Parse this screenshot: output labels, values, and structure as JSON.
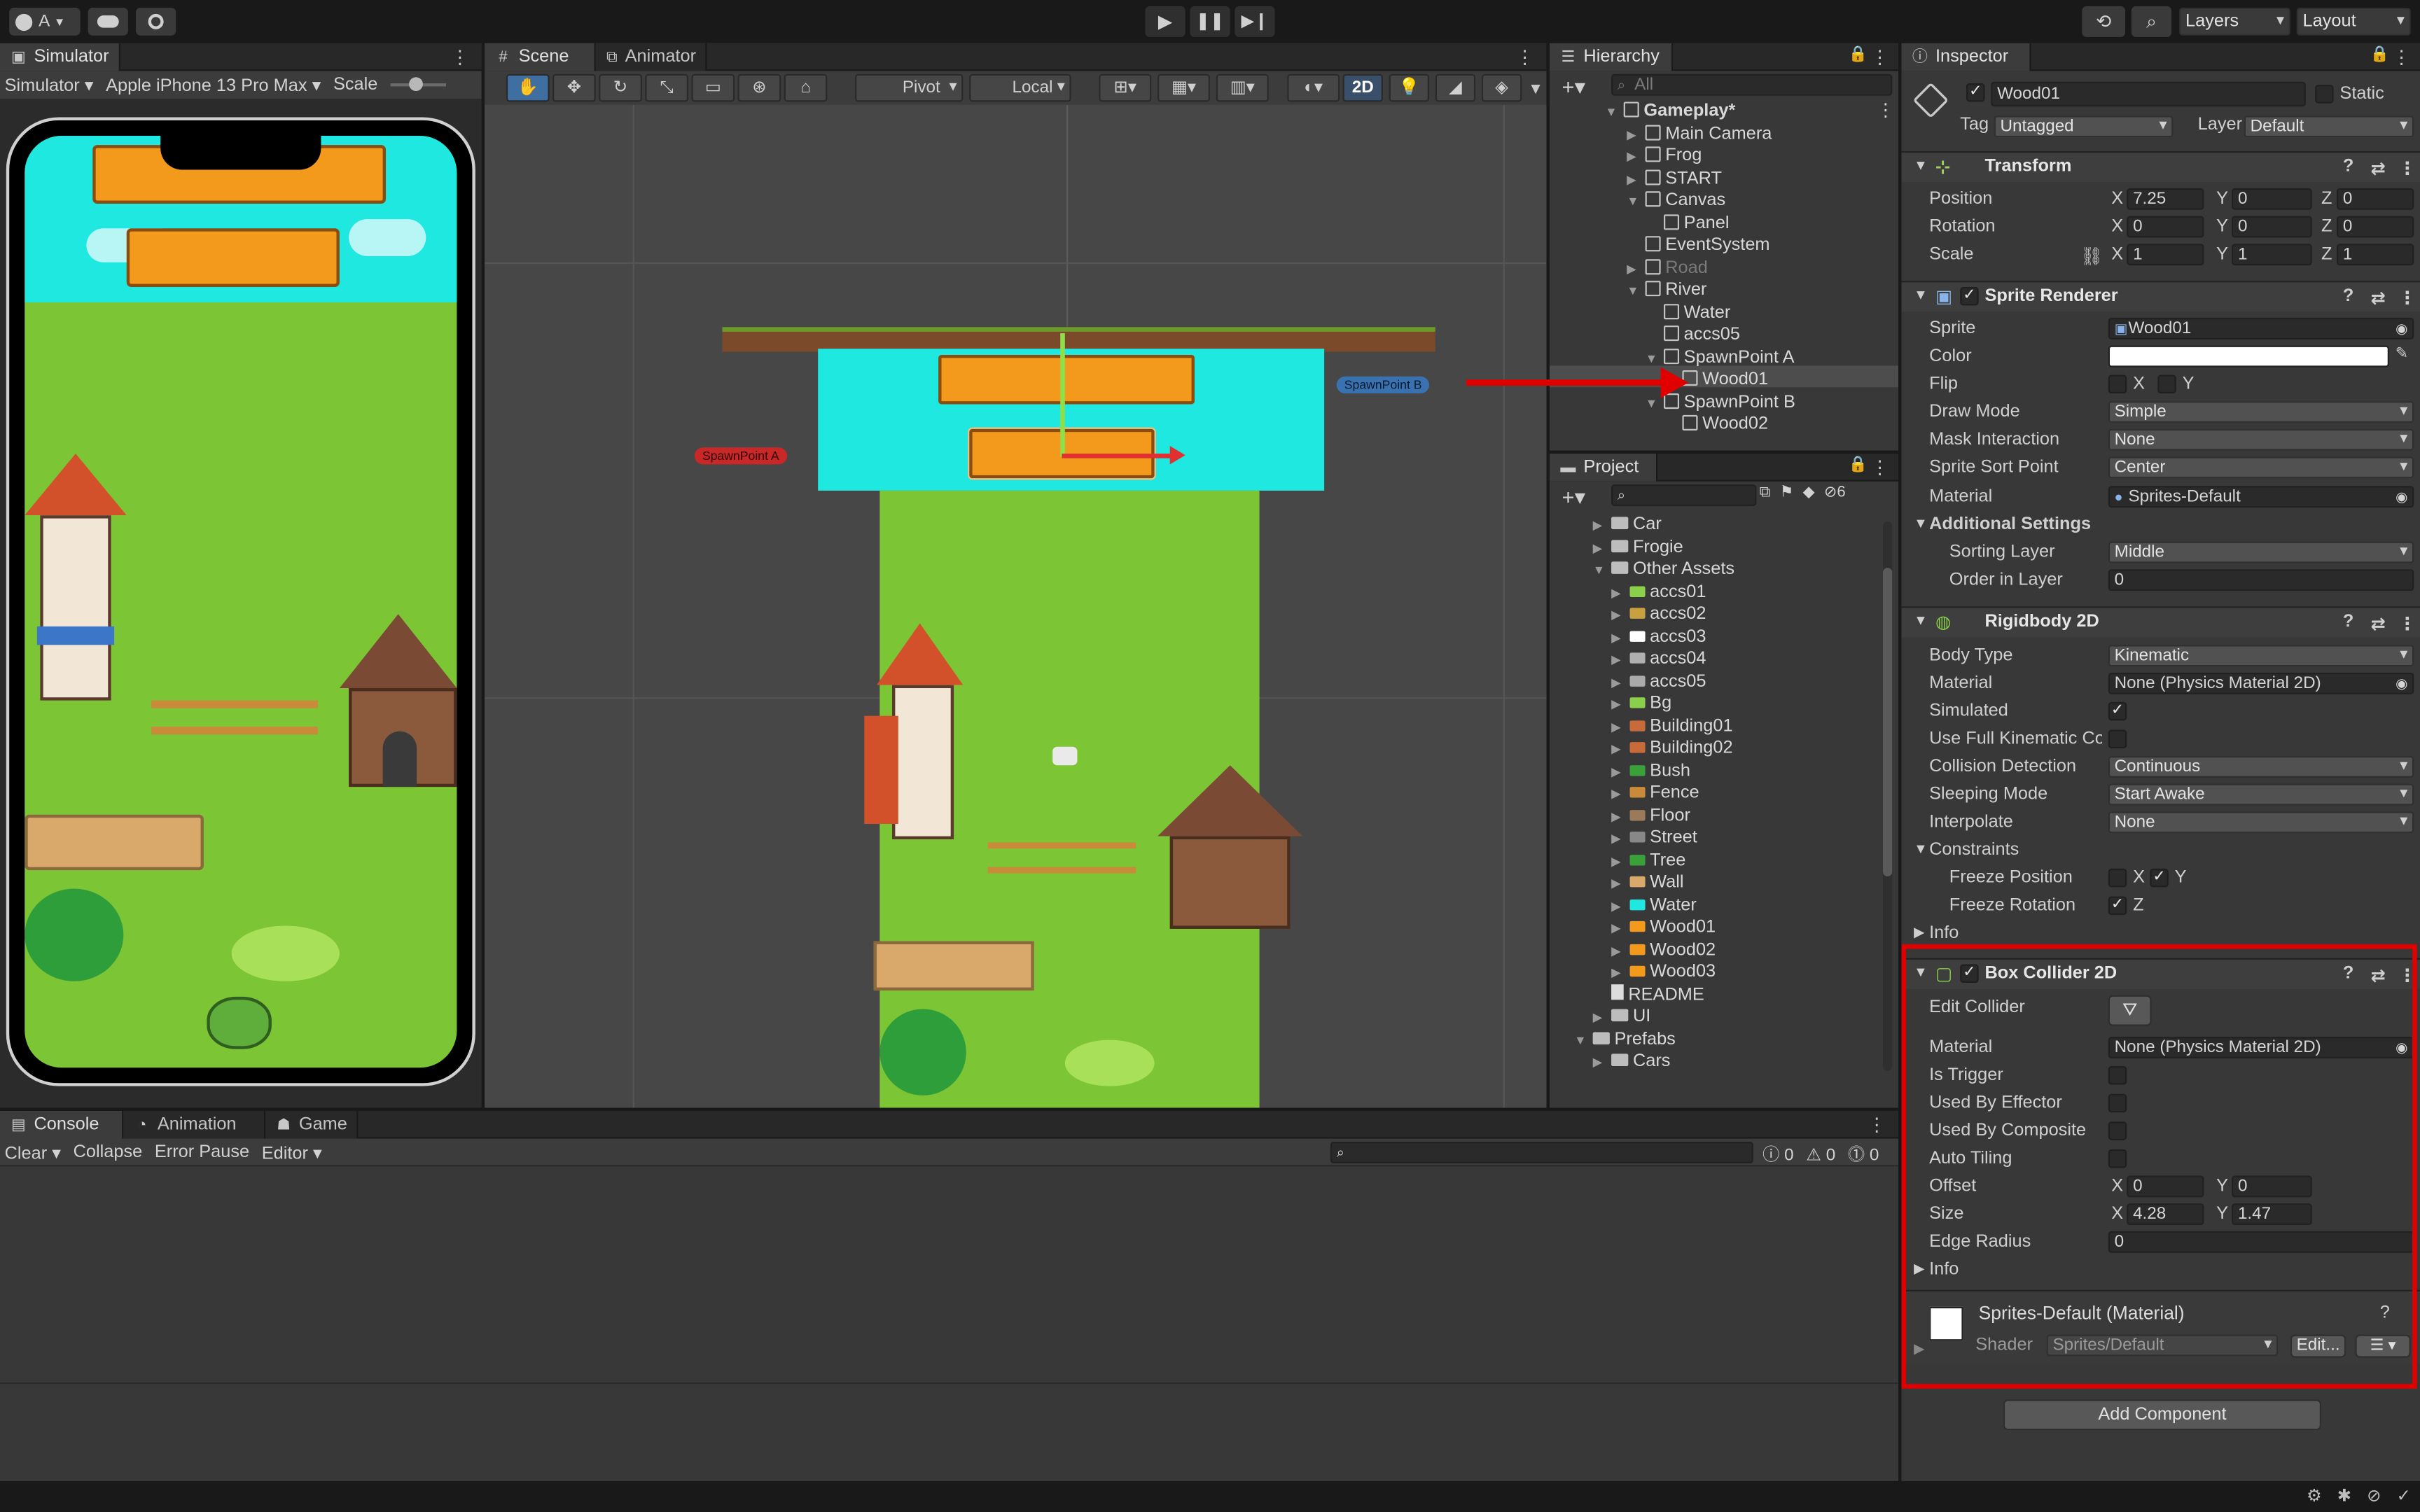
{
  "toolbar": {
    "account": "A",
    "layers": "Layers",
    "layout": "Layout"
  },
  "simulator": {
    "tab": "Simulator",
    "mode": "Simulator",
    "device": "Apple iPhone 13 Pro Max",
    "scale_label": "Scale"
  },
  "scene": {
    "tab_scene": "Scene",
    "tab_animator": "Animator",
    "pivot": "Pivot",
    "local": "Local",
    "two_d": "2D",
    "spawn_a": "SpawnPoint A",
    "spawn_b": "SpawnPoint B"
  },
  "hierarchy": {
    "tab": "Hierarchy",
    "search_placeholder": "All",
    "items": [
      {
        "label": "Gameplay*",
        "indent": 0
      },
      {
        "label": "Main Camera",
        "indent": 1
      },
      {
        "label": "Frog",
        "indent": 1
      },
      {
        "label": "START",
        "indent": 1
      },
      {
        "label": "Canvas",
        "indent": 1
      },
      {
        "label": "Panel",
        "indent": 2
      },
      {
        "label": "EventSystem",
        "indent": 1
      },
      {
        "label": "Road",
        "indent": 1
      },
      {
        "label": "River",
        "indent": 1
      },
      {
        "label": "Water",
        "indent": 2
      },
      {
        "label": "accs05",
        "indent": 2
      },
      {
        "label": "SpawnPoint A",
        "indent": 2
      },
      {
        "label": "Wood01",
        "indent": 3
      },
      {
        "label": "SpawnPoint B",
        "indent": 2
      },
      {
        "label": "Wood02",
        "indent": 3
      }
    ]
  },
  "project": {
    "tab": "Project",
    "hidden_count": "6",
    "items": [
      {
        "label": "Car",
        "depth": 1,
        "icon": "folder-icon"
      },
      {
        "label": "Frogie",
        "depth": 1,
        "icon": "folder-icon"
      },
      {
        "label": "Other Assets",
        "depth": 1,
        "icon": "folder-open-icon"
      },
      {
        "label": "accs01",
        "depth": 2,
        "icon": "sprite-icon"
      },
      {
        "label": "accs02",
        "depth": 2,
        "icon": "sprite-icon"
      },
      {
        "label": "accs03",
        "depth": 2,
        "icon": "sprite-icon"
      },
      {
        "label": "accs04",
        "depth": 2,
        "icon": "sprite-icon"
      },
      {
        "label": "accs05",
        "depth": 2,
        "icon": "sprite-icon"
      },
      {
        "label": "Bg",
        "depth": 2,
        "icon": "sprite-icon"
      },
      {
        "label": "Building01",
        "depth": 2,
        "icon": "sprite-icon"
      },
      {
        "label": "Building02",
        "depth": 2,
        "icon": "sprite-icon"
      },
      {
        "label": "Bush",
        "depth": 2,
        "icon": "sprite-icon"
      },
      {
        "label": "Fence",
        "depth": 2,
        "icon": "sprite-icon"
      },
      {
        "label": "Floor",
        "depth": 2,
        "icon": "sprite-icon"
      },
      {
        "label": "Street",
        "depth": 2,
        "icon": "sprite-icon"
      },
      {
        "label": "Tree",
        "depth": 2,
        "icon": "sprite-icon"
      },
      {
        "label": "Wall",
        "depth": 2,
        "icon": "sprite-icon"
      },
      {
        "label": "Water",
        "depth": 2,
        "icon": "sprite-icon"
      },
      {
        "label": "Wood01",
        "depth": 2,
        "icon": "sprite-icon"
      },
      {
        "label": "Wood02",
        "depth": 2,
        "icon": "sprite-icon"
      },
      {
        "label": "Wood03",
        "depth": 2,
        "icon": "sprite-icon"
      },
      {
        "label": "README",
        "depth": 1,
        "icon": "doc-icon"
      },
      {
        "label": "UI",
        "depth": 1,
        "icon": "folder-icon"
      },
      {
        "label": "Prefabs",
        "depth": 0,
        "icon": "folder-open-icon"
      },
      {
        "label": "Cars",
        "depth": 1,
        "icon": "folder-icon"
      }
    ]
  },
  "console": {
    "tab_console": "Console",
    "tab_animation": "Animation",
    "tab_game": "Game",
    "clear": "Clear",
    "collapse": "Collapse",
    "error_pause": "Error Pause",
    "editor": "Editor",
    "count_log": "0",
    "count_warn": "0",
    "count_err": "0"
  },
  "inspector": {
    "tab": "Inspector",
    "name": "Wood01",
    "static": "Static",
    "tag_label": "Tag",
    "tag": "Untagged",
    "layer_label": "Layer",
    "layer": "Default",
    "transform": {
      "title": "Transform",
      "position": {
        "label": "Position",
        "x": "7.25",
        "y": "0",
        "z": "0"
      },
      "rotation": {
        "label": "Rotation",
        "x": "0",
        "y": "0",
        "z": "0"
      },
      "scale": {
        "label": "Scale",
        "x": "1",
        "y": "1",
        "z": "1"
      }
    },
    "sprite_renderer": {
      "title": "Sprite Renderer",
      "sprite_label": "Sprite",
      "sprite": "Wood01",
      "color_label": "Color",
      "flip_label": "Flip",
      "draw_mode_label": "Draw Mode",
      "draw_mode": "Simple",
      "mask_label": "Mask Interaction",
      "mask": "None",
      "sort_point_label": "Sprite Sort Point",
      "sort_point": "Center",
      "material_label": "Material",
      "material": "Sprites-Default",
      "additional": "Additional Settings",
      "sorting_layer_label": "Sorting Layer",
      "sorting_layer": "Middle",
      "order_label": "Order in Layer",
      "order": "0"
    },
    "rigidbody": {
      "title": "Rigidbody 2D",
      "body_type_label": "Body Type",
      "body_type": "Kinematic",
      "material_label": "Material",
      "material": "None (Physics Material 2D)",
      "simulated_label": "Simulated",
      "full_kinematic_label": "Use Full Kinematic Cor",
      "collision_label": "Collision Detection",
      "collision": "Continuous",
      "sleeping_label": "Sleeping Mode",
      "sleeping": "Start Awake",
      "interpolate_label": "Interpolate",
      "interpolate": "None",
      "constraints": "Constraints",
      "freeze_pos_label": "Freeze Position",
      "freeze_rot_label": "Freeze Rotation",
      "info": "Info"
    },
    "box_collider": {
      "title": "Box Collider 2D",
      "edit_label": "Edit Collider",
      "material_label": "Material",
      "material": "None (Physics Material 2D)",
      "trigger_label": "Is Trigger",
      "effector_label": "Used By Effector",
      "composite_label": "Used By Composite",
      "tiling_label": "Auto Tiling",
      "offset_label": "Offset",
      "offset_x": "0",
      "offset_y": "0",
      "size_label": "Size",
      "size_x": "4.28",
      "size_y": "1.47",
      "edge_label": "Edge Radius",
      "edge": "0",
      "info": "Info"
    },
    "material_block": {
      "title": "Sprites-Default (Material)",
      "shader_label": "Shader",
      "shader": "Sprites/Default",
      "edit": "Edit..."
    },
    "add_component": "Add Component"
  },
  "axes": {
    "x": "X",
    "y": "Y",
    "z": "Z"
  },
  "colors": {
    "highlight": "#e00000",
    "accent": "#3a72b0",
    "water": "#1ee8e0",
    "grass": "#7cc534",
    "wood": "#f39a1c"
  }
}
